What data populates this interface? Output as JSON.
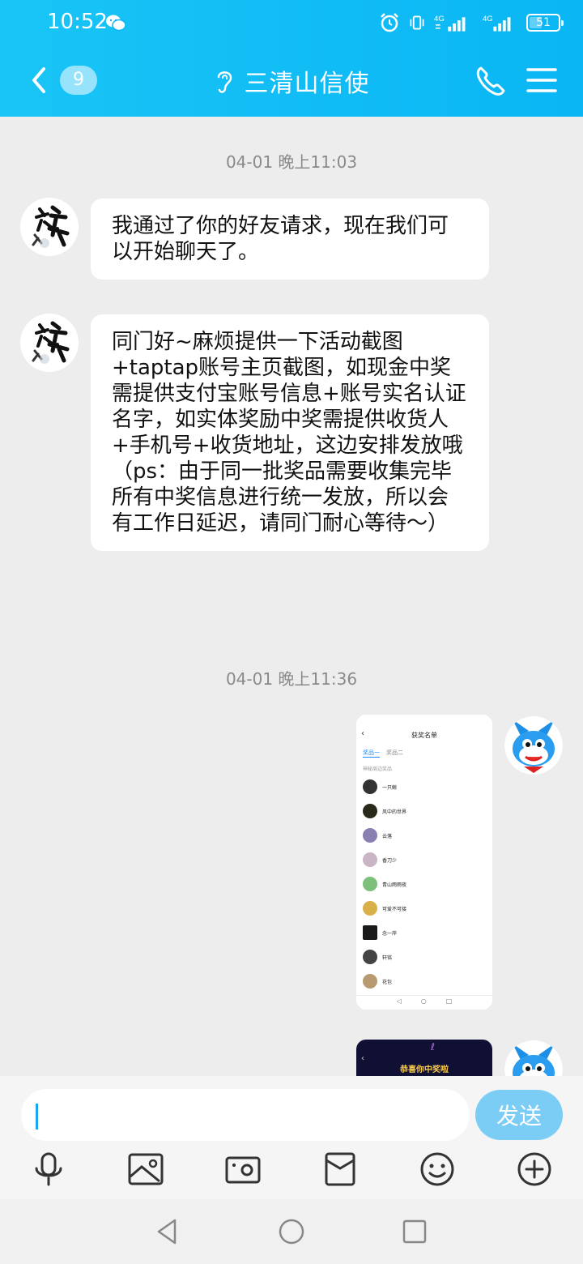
{
  "status_bar": {
    "time": "10:52",
    "network_1": "4G",
    "network_2": "4G",
    "battery": "51",
    "battery_level": 0.51
  },
  "header": {
    "back_badge": "9",
    "title": "三清山信使"
  },
  "messages": {
    "timestamp_1": "04-01 晚上11:03",
    "msg_1": "我通过了你的好友请求，现在我们可以开始聊天了。",
    "msg_2": "同门好~麻烦提供一下活动截图+taptap账号主页截图，如现金中奖需提供支付宝账号信息+账号实名认证名字，如实体奖励中奖需提供收货人+手机号+收货地址，这边安排发放哦\n（ps：由于同一批奖品需要收集完毕所有中奖信息进行统一发放，所以会有工作日延迟，请同门耐心等待～）",
    "timestamp_2": "04-01 晚上11:36"
  },
  "image_1": {
    "title": "获奖名单",
    "tab_1": "奖品一",
    "tab_2": "奖品二",
    "section": "神秘周边奖品",
    "winners": [
      "一只鲸",
      "风中的世界",
      "云落",
      "香刀少",
      "青山雨雨夜",
      "可爱不可接",
      "念一岸",
      "轩铭",
      "花包"
    ]
  },
  "image_2": {
    "caption": "恭喜你中奖啦"
  },
  "input": {
    "value": "",
    "send_label": "发送"
  },
  "colors": {
    "header": "#19c4f6",
    "send_button": "#7ccdf6",
    "background": "#ededed"
  }
}
